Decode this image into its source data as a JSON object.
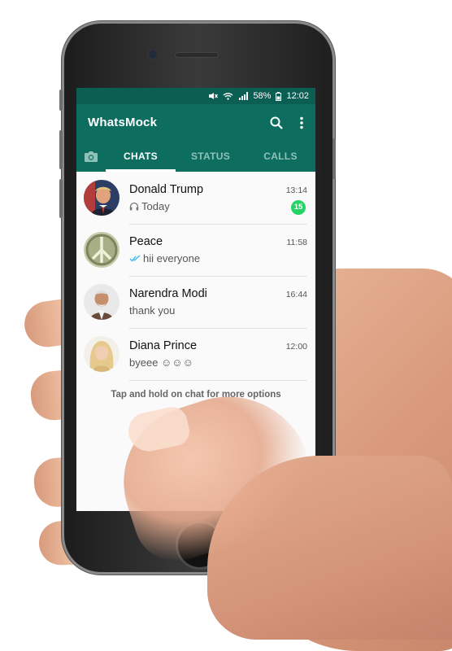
{
  "status_bar": {
    "battery": "58%",
    "time": "12:02"
  },
  "app_bar": {
    "title": "WhatsMock",
    "search_icon": "search-icon",
    "menu_icon": "more-vert-icon"
  },
  "tabs": [
    {
      "label": "CHATS",
      "active": true
    },
    {
      "label": "STATUS",
      "active": false
    },
    {
      "label": "CALLS",
      "active": false
    }
  ],
  "chats": [
    {
      "name": "Donald Trump",
      "time": "13:14",
      "preview": "Today",
      "preview_icon": "headphones-icon",
      "unread": "15"
    },
    {
      "name": "Peace",
      "time": "11:58",
      "preview": "hii everyone",
      "preview_icon": "double-check-icon"
    },
    {
      "name": "Narendra Modi",
      "time": "16:44",
      "preview": "thank you"
    },
    {
      "name": "Diana Prince",
      "time": "12:00",
      "preview": "byeee ☺☺☺"
    }
  ],
  "hint": "Tap and hold on chat for more options",
  "colors": {
    "header": "#0d6e60",
    "status_bar": "#0a5e52",
    "unread_badge": "#25d366",
    "read_tick": "#34b7f1"
  }
}
